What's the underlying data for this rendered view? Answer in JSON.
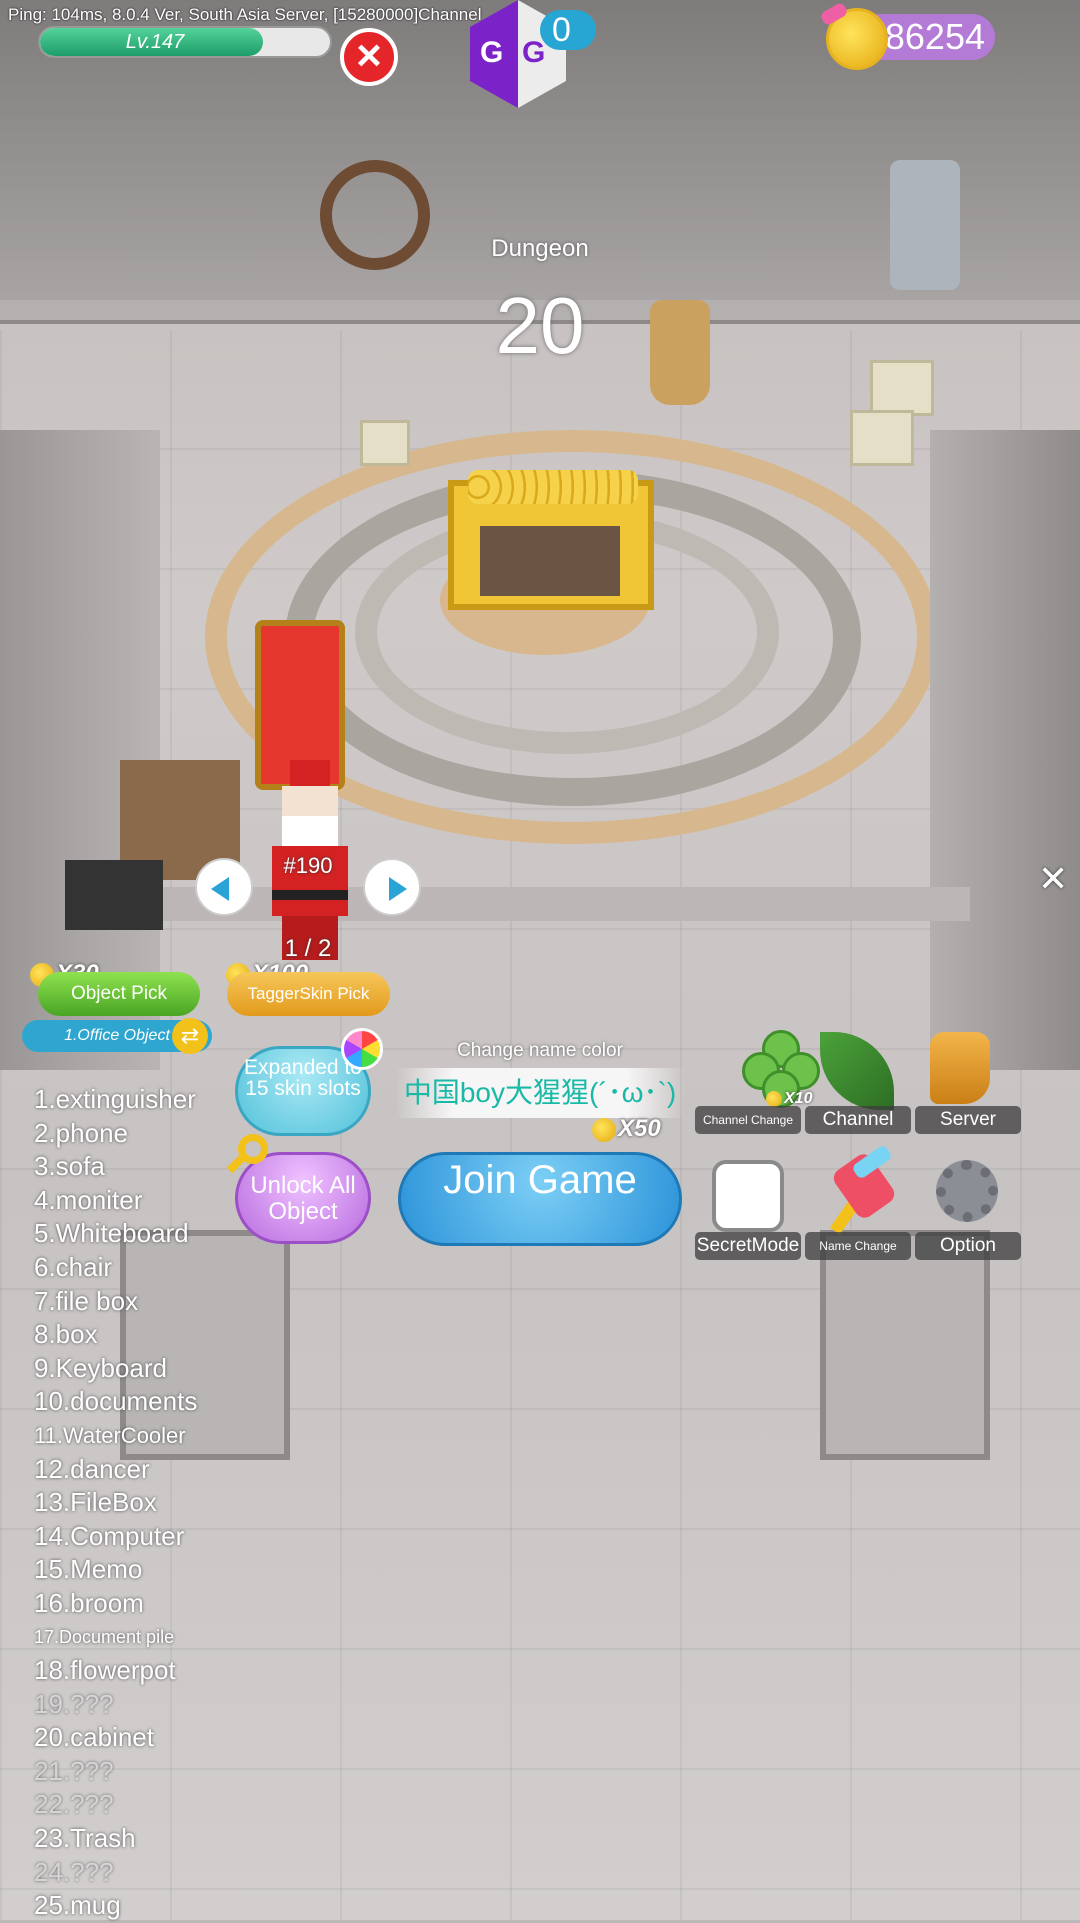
{
  "status": {
    "ping": "Ping: 104ms, 8.0.4 Ver, South Asia Server, [15280000]Channel"
  },
  "level": {
    "label": "Lv.147",
    "progress": 0.77
  },
  "overlay": {
    "gg_letters": [
      "G",
      "G"
    ],
    "pill_text": "0"
  },
  "currency": {
    "coins": "86254"
  },
  "game": {
    "map_name": "Dungeon",
    "countdown": "20"
  },
  "skin": {
    "number": "#190",
    "page": "1 / 2"
  },
  "shop": {
    "object_pick": {
      "price": "X30",
      "label": "Object Pick"
    },
    "tagger_pick": {
      "price": "X100",
      "label": "TaggerSkin Pick"
    },
    "category": "1.Office Object",
    "expand_label": "Expanded to 15 skin slots",
    "unlock_label": "Unlock All Object"
  },
  "name_color": {
    "label": "Change name color",
    "player_name": "中国boy大猩猩(´･ω･`)",
    "price": "X50"
  },
  "join_label": "Join Game",
  "menu": {
    "channel_change": {
      "label": "Channel Change",
      "price": "X10"
    },
    "channel": "Channel",
    "server": "Server",
    "secret_mode": "SecretMode",
    "name_change": "Name Change",
    "option": "Option"
  },
  "objects": [
    {
      "label": "1.extinguisher",
      "state": "normal"
    },
    {
      "label": "2.phone",
      "state": "normal"
    },
    {
      "label": "3.sofa",
      "state": "selected"
    },
    {
      "label": "4.moniter",
      "state": "normal"
    },
    {
      "label": "5.Whiteboard",
      "state": "normal"
    },
    {
      "label": "6.chair",
      "state": "normal"
    },
    {
      "label": "7.file box",
      "state": "normal"
    },
    {
      "label": "8.box",
      "state": "normal"
    },
    {
      "label": "9.Keyboard",
      "state": "normal"
    },
    {
      "label": "10.documents",
      "state": "normal"
    },
    {
      "label": "11.WaterCooler",
      "state": "normal",
      "size": "medium"
    },
    {
      "label": "12.dancer",
      "state": "normal"
    },
    {
      "label": "13.FileBox",
      "state": "normal"
    },
    {
      "label": "14.Computer",
      "state": "normal"
    },
    {
      "label": "15.Memo",
      "state": "normal"
    },
    {
      "label": "16.broom",
      "state": "normal"
    },
    {
      "label": "17.Document pile",
      "state": "normal",
      "size": "small"
    },
    {
      "label": "18.flowerpot",
      "state": "normal"
    },
    {
      "label": "19.???",
      "state": "locked"
    },
    {
      "label": "20.cabinet",
      "state": "normal"
    },
    {
      "label": "21.???",
      "state": "locked"
    },
    {
      "label": "22.???",
      "state": "locked"
    },
    {
      "label": "23.Trash",
      "state": "normal"
    },
    {
      "label": "24.???",
      "state": "locked"
    },
    {
      "label": "25.mug",
      "state": "normal"
    }
  ]
}
